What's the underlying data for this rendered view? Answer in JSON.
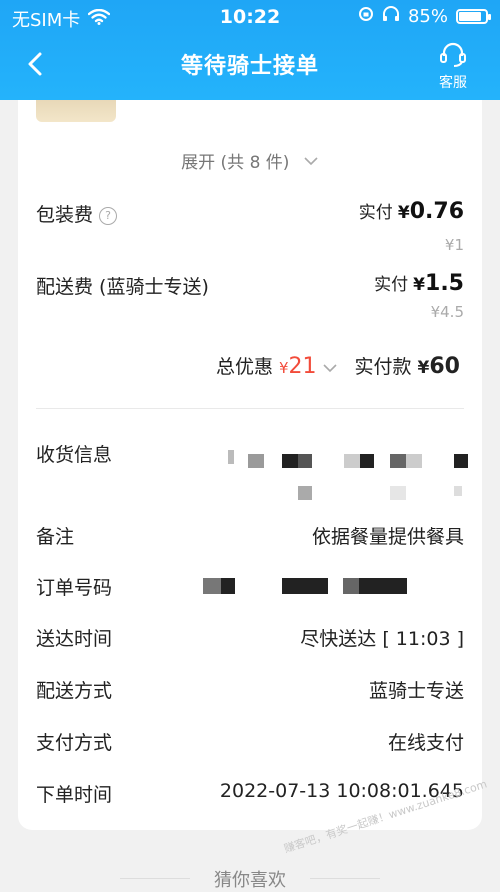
{
  "status_bar": {
    "carrier": "无SIM卡",
    "time": "10:22",
    "battery_percent": "85%",
    "battery_level": 0.85
  },
  "nav": {
    "title": "等待骑士接单",
    "service_label": "客服"
  },
  "order": {
    "expand_label": "展开 (共 8 件)",
    "packaging": {
      "label": "包装费",
      "actual_label": "实付",
      "currency": "¥",
      "actual_value": "0.76",
      "original": "¥1"
    },
    "delivery": {
      "label": "配送费 (蓝骑士专送)",
      "actual_label": "实付",
      "currency": "¥",
      "actual_value": "1.5",
      "original": "¥4.5"
    },
    "summary": {
      "discount_label": "总优惠",
      "discount_currency": "¥",
      "discount_value": "21",
      "paid_label": "实付款",
      "paid_currency": "¥",
      "paid_value": "60"
    }
  },
  "info": {
    "receiver_label": "收货信息",
    "remark_label": "备注",
    "remark_value": "依据餐量提供餐具",
    "order_no_label": "订单号码",
    "arrival_label": "送达时间",
    "arrival_value": "尽快送达 [ 11:03 ]",
    "delivery_method_label": "配送方式",
    "delivery_method_value": "蓝骑士专送",
    "payment_label": "支付方式",
    "payment_value": "在线支付",
    "order_time_label": "下单时间",
    "order_time_value": "2022-07-13 10:08:01.645"
  },
  "footer": {
    "guess_label": "猜你喜欢"
  },
  "watermark": "赚客吧，有奖一起赚！www.zuanke8.com",
  "colors": {
    "header": "#21aef8",
    "discount": "#f24b3a"
  }
}
